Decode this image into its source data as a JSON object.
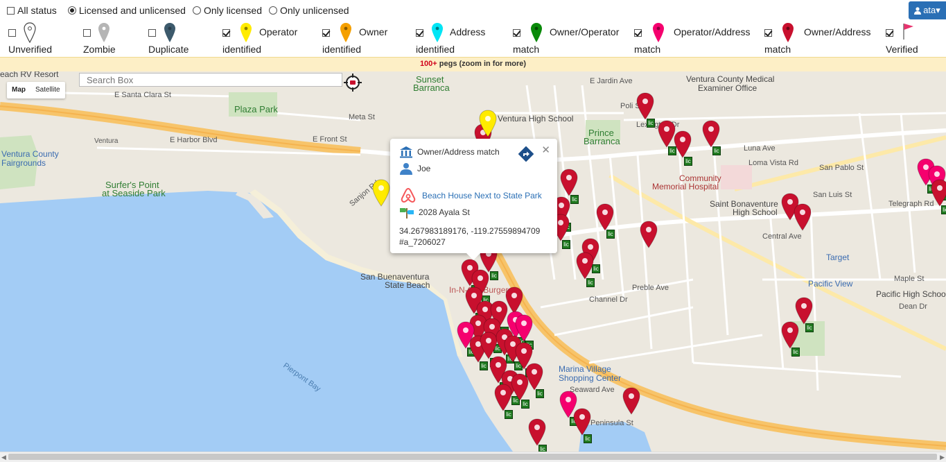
{
  "status_filter": {
    "all_status": "All status",
    "options": [
      "Licensed and unlicensed",
      "Only licensed",
      "Only unlicensed"
    ],
    "selected": "Licensed and unlicensed"
  },
  "user": {
    "label": "ata▾"
  },
  "legend": [
    {
      "l1": "",
      "l2": "Unverified",
      "checked": false,
      "color": "#ffffff"
    },
    {
      "l1": "",
      "l2": "Zombie",
      "checked": false,
      "color": "#b5b5b5"
    },
    {
      "l1": "",
      "l2": "Duplicate",
      "checked": false,
      "color": "#3d5a6c"
    },
    {
      "l1": "Operator",
      "l2": "identified",
      "checked": true,
      "color": "#ffeb00"
    },
    {
      "l1": "Owner",
      "l2": "identified",
      "checked": true,
      "color": "#f5a000"
    },
    {
      "l1": "Address",
      "l2": "identified",
      "checked": true,
      "color": "#00e5f5"
    },
    {
      "l1": "Owner/Operator",
      "l2": "match",
      "checked": true,
      "color": "#0a8a0a"
    },
    {
      "l1": "Operator/Address",
      "l2": "match",
      "checked": true,
      "color": "#f5006e"
    },
    {
      "l1": "Owner/Address",
      "l2": "match",
      "checked": true,
      "color": "#c8102e"
    },
    {
      "l1": "",
      "l2": "Verified",
      "checked": true,
      "color": "#e8336e"
    }
  ],
  "banner": {
    "count": "100+",
    "text": " pegs (zoom in for more)"
  },
  "map": {
    "search_placeholder": "Search Box",
    "map_type": [
      "Map",
      "Satellite"
    ],
    "lic_label": "lic",
    "labels": {
      "l1": "Ventura High School",
      "l2": "Ventura County Medical",
      "l3": "Examiner Office",
      "l4": "Plaza Park",
      "l5": "Ventura County",
      "l6": "Fairgrounds",
      "l7": "Surfer's Point",
      "l8": "at Seaside Park",
      "l9": "San Buenaventura",
      "l10": "State Beach",
      "l11": "Prince",
      "l12": "Barranca",
      "l13": "Community",
      "l14": "Memorial Hospital",
      "l15": "Saint Bonaventure",
      "l16": "High School",
      "l17": "Target",
      "l18": "Pacific View",
      "l19": "Pacific High School",
      "l20": "Marina Village",
      "l21": "Shopping Center",
      "l22": "Pierpont Bay",
      "l23": "Sunset",
      "l24": "Barranca",
      "l25": "E Santa Clara St",
      "l26": "E Harbor Blvd",
      "l27": "E Front St",
      "l28": "Meta St",
      "l29": "Poli St",
      "l30": "Loma Vista Rd",
      "l31": "Telegraph Rd",
      "l32": "Central Ave",
      "l33": "Preble Ave",
      "l34": "Channel Dr",
      "l35": "Ventura",
      "l36": "each RV Resort",
      "l37": "In-N-Out Burger",
      "l38": "E Jardin Ave",
      "l39": "Lexington Dr",
      "l40": "Luna Ave",
      "l41": "San Pablo St",
      "l42": "San Luis St",
      "l43": "Maple St",
      "l44": "Dean Dr",
      "l45": "Sanjon Rd",
      "l46": "Seaward Ave",
      "l47": "Peninsula St"
    }
  },
  "popup": {
    "match_type": "Owner/Address match",
    "owner": "Joe",
    "listing_title": "Beach House Next to State Park",
    "address": "2028 Ayala St",
    "coords": "34.267983189176, -119.27559894709",
    "listing_id": "#a_7206027"
  }
}
